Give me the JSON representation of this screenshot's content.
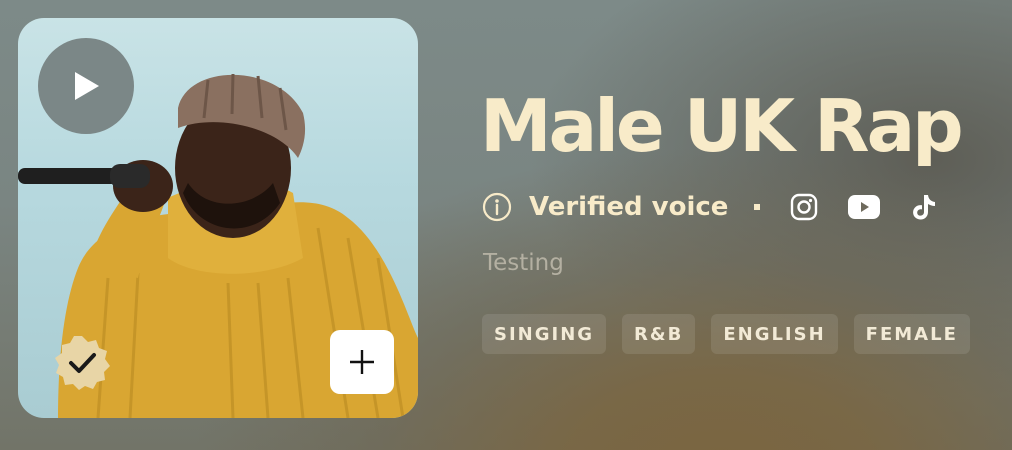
{
  "voice": {
    "title": "Male UK Rap",
    "verified_label": "Verified voice",
    "subtitle": "Testing",
    "tags": [
      "SINGING",
      "R&B",
      "ENGLISH",
      "FEMALE"
    ]
  },
  "cover": {
    "play_icon": "play-icon",
    "verified_badge_icon": "verified-check-badge-icon",
    "add_icon": "plus-icon"
  },
  "social_icons": [
    "instagram-icon",
    "youtube-icon",
    "tiktok-icon"
  ],
  "colors": {
    "accent_text": "#f8ebc9",
    "subtitle_text": "#b4b0a2",
    "badge_gold": "#e8d5a6"
  }
}
